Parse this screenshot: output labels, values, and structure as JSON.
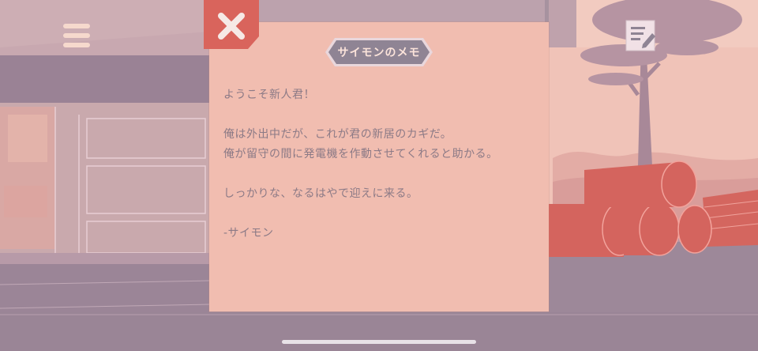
{
  "hud": {
    "menu_icon": "hamburger-menu-icon",
    "notes_icon": "memo-note-icon"
  },
  "note": {
    "close_icon": "close-x-icon",
    "title": "サイモンのメモ",
    "lines": [
      "ようこそ新人君！",
      "",
      "俺は外出中だが、これが君の新居のカギだ。",
      "俺が留守の間に発電機を作動させてくれると助かる。",
      "",
      "しっかりな、なるはやで迎えに来る。",
      "",
      "-サイモン"
    ]
  },
  "colors": {
    "paper": "#f1bdb0",
    "close_button": "#d9645c",
    "title_badge": "#8f8494",
    "body_text": "#8c7a86",
    "logs": "#d4645e"
  }
}
